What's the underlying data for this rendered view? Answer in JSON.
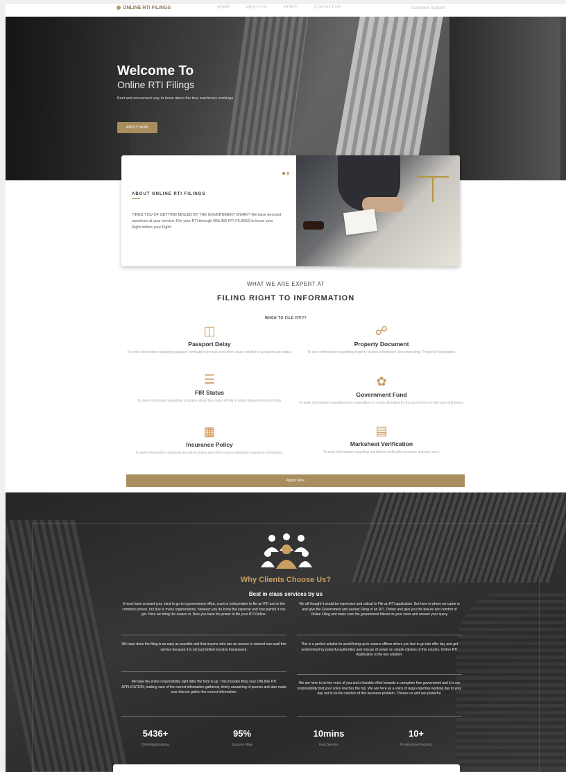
{
  "nav": {
    "logo": "ONLINE RTI FILINGS",
    "links": [
      "HOME",
      "ABOUT US",
      "RTI/RTI",
      "CONTACT US"
    ],
    "right": "Customer Support"
  },
  "hero": {
    "title": "Welcome To",
    "subtitle": "Online RTI Filings",
    "text": "Best and convenient way to know about the true machinery workings",
    "button": "APPLY NOW"
  },
  "about": {
    "heading": "ABOUT ONLINE RTI FILINGS",
    "body": "TIRED YOU OF GETTING MISLED BY THE GOVERNMENT WORK? We have devoted ourselves at your service. File your RTI through ONLINE RTI FILINGS to know your Right before your Fight!"
  },
  "expert": {
    "small_title": "WHAT WE ARE EXPERT AT",
    "title": "FILING RIGHT TO INFORMATION",
    "sub": "WHEN TO FILE RTI??"
  },
  "services": [
    {
      "icon": "passport-icon",
      "title": "Passport Delay",
      "desc": "To seek information regarding passport verification process and other issues related to passport and status."
    },
    {
      "icon": "document-icon",
      "title": "Property Document",
      "desc": "To seek information regarding property related information, like ownership, Property Registration."
    },
    {
      "icon": "fir-icon",
      "title": "FIR Status",
      "desc": "To seek information regarding progress about the status of FIR in police department and India."
    },
    {
      "icon": "fund-icon",
      "title": "Government Fund",
      "desc": "To seek information regarding fund expenditure or funds allocated by the government in the past and future."
    },
    {
      "icon": "insurance-icon",
      "title": "Insurance Policy",
      "desc": "To seek information regarding insurance policy and other issues related to insurance companies."
    },
    {
      "icon": "marksheet-icon",
      "title": "Marksheet Verification",
      "desc": "To seek information regarding marksheet verification process and any more."
    }
  ],
  "apply_bar": "Apply Now",
  "clients": {
    "title": "Why Clients Choose Us?",
    "subtitle": "Best in class services by us",
    "paragraphs": [
      "It must have crossed your mind to go to a government office, court or policymaker to file an RTI and to the common person, but due to many organizations, however you do know the expense and how painful it can get. Here we bring the reason in. Now you have the power to file your RTI Online.",
      "We all thought it would be expensive and critical to File an RTI application. But here is where we came in and give the Government and easiest Filing of an RTI. Online and give you the leisure and comfort of Online Filing and make sure the government follows to your voice and answer your query.",
      "We have done the filing is as easy as possible and that anyone who has an access to internet can avail this service because it is not just limited but also transparent.",
      "This is a perfect solution to avoid lining up in various offices where you feel to go into offer day and get undermined by powerful authorities and misuse of power on simple citizens of this country. Online RTI Application is the key solution.",
      "We take the entire responsibility right after the form is up. This includes filing your ONLINE RTI APPLICATION, making sure of the correct information gathered, timely answering of queries and also make sure that we gather the correct information.",
      "We are here to be the voice of you and a humble effort towards a corruption free government and it is our responsibility that your voice reaches the top. We are here as a voice of legal expertise working day to your day not to be the solution of this business problem. Choose us and see powerful."
    ],
    "stats": [
      {
        "num": "5436+",
        "label": "Client Applications"
      },
      {
        "num": "95%",
        "label": "Success Rate"
      },
      {
        "num": "10mins",
        "label": "Fast Service"
      },
      {
        "num": "10+",
        "label": "Professional Experts"
      }
    ]
  },
  "colors": {
    "accent": "#a88d5e",
    "gold_text": "#c9a060"
  }
}
